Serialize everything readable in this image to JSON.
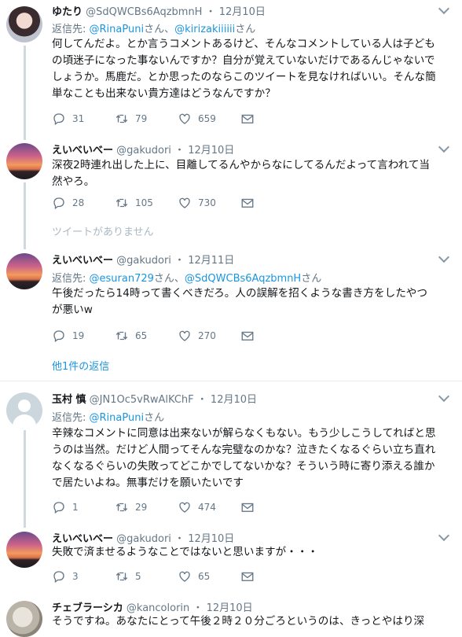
{
  "tweets": [
    {
      "name": "ゆたり",
      "handle": "@SdQWCBs6AqzbmnH",
      "date": "12月10日",
      "reply_label": "返信先: ",
      "reply_users": [
        "@RinaPuni",
        "@kirizakiiiiii"
      ],
      "reply_sep": "さん、",
      "reply_suffix": "さん",
      "text": "何してんだよ。とか言うコメントあるけど、そんなコメントしている人は子どもの頃迷子になった事ないんですか？自分が覚えていないだけであるんじゃないでしょうか。馬鹿だ。とか思ったのならこのツイートを見なければいい。そんな簡単なことも出来ない貴方達はどうなんですか？",
      "replies": "31",
      "retweets": "79",
      "likes": "659"
    },
    {
      "name": "えいべいべー",
      "handle": "@gakudori",
      "date": "12月10日",
      "text": "深夜2時連れ出した上に、目離してるんやからなにしてるんだよって言われて当然やろ。",
      "replies": "28",
      "retweets": "105",
      "likes": "730"
    },
    {
      "name": "えいべいべー",
      "handle": "@gakudori",
      "date": "12月11日",
      "reply_label": "返信先: ",
      "reply_users": [
        "@esuran729",
        "@SdQWCBs6AqzbmnH"
      ],
      "reply_sep": "さん、",
      "reply_suffix": "さん",
      "text": "午後だったら14時って書くべきだろ。人の誤解を招くような書き方をしたやつが悪いw",
      "replies": "19",
      "retweets": "65",
      "likes": "270"
    },
    {
      "name": "玉村 慎",
      "handle": "@JN1Oc5vRwAlKChF",
      "date": "12月10日",
      "reply_label": "返信先: ",
      "reply_users": [
        "@RinaPuni"
      ],
      "reply_suffix": "さん",
      "text": "辛辣なコメントに同意は出来ないが解らなくもない。もう少しこうしてればと思うのは当然。だけど人間ってそんな完璧なのかな？泣きたくなるぐらい立ち直れなくなるぐらいの失敗ってどこかでしてないかな？そういう時に寄り添える誰かで居たいよね。無事だけを願いたいです",
      "replies": "1",
      "retweets": "29",
      "likes": "474"
    },
    {
      "name": "えいべいべー",
      "handle": "@gakudori",
      "date": "12月10日",
      "text": "失敗で済ませるようなことではないと思いますが・・・",
      "replies": "3",
      "retweets": "5",
      "likes": "65"
    },
    {
      "name": "チェブラーシカ",
      "handle": "@kancolorin",
      "date": "12月10日",
      "text": "そうですね。あなたにとって午後２時２０分ごろというのは、きっとやはり深"
    }
  ],
  "unavailable_text": "ツイートがありません",
  "more_replies_text": "他1件の返信",
  "date_sep": "・",
  "icons": {
    "reply": "reply-icon",
    "retweet": "retweet-icon",
    "like": "heart-icon",
    "dm": "mail-icon",
    "more": "chevron-down-icon"
  },
  "colors": {
    "link": "#1b95e0",
    "meta": "#657786",
    "line": "#cfd9de"
  }
}
